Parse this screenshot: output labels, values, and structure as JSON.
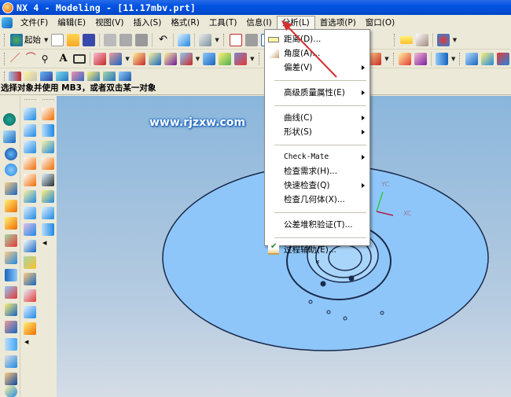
{
  "window": {
    "title": "NX 4 - Modeling - [11.17mbv.prt]"
  },
  "menubar": {
    "items": [
      {
        "label": "文件(F)"
      },
      {
        "label": "编辑(E)"
      },
      {
        "label": "视图(V)"
      },
      {
        "label": "插入(S)"
      },
      {
        "label": "格式(R)"
      },
      {
        "label": "工具(T)"
      },
      {
        "label": "信息(I)"
      },
      {
        "label": "分析(L)",
        "active": true
      },
      {
        "label": "首选项(P)"
      },
      {
        "label": "窗口(O)"
      }
    ]
  },
  "toolbar": {
    "start_label": "起始"
  },
  "prompt": {
    "text": "选择对象并使用 MB3，或者双击某一对象"
  },
  "viewport": {
    "watermark": "www.rjzxw.com",
    "model_color": "#8ec6fa",
    "axis_labels": {
      "x": "XC",
      "y": "YC"
    }
  },
  "analysis_menu": {
    "items": [
      {
        "label": "距离(D)...",
        "icon": "distance-icon",
        "submenu": false
      },
      {
        "label": "角度(A)...",
        "icon": "angle-icon",
        "submenu": false
      },
      {
        "label": "偏差(V)",
        "submenu": true
      },
      {
        "separator": true
      },
      {
        "label": "高级质量属性(E)",
        "submenu": true
      },
      {
        "separator": true
      },
      {
        "label": "曲线(C)",
        "submenu": true
      },
      {
        "label": "形状(S)",
        "submenu": true
      },
      {
        "separator": true
      },
      {
        "label": "Check-Mate",
        "submenu": true
      },
      {
        "label": "检查需求(H)...",
        "submenu": false
      },
      {
        "label": "快速检查(Q)",
        "submenu": true
      },
      {
        "label": "检查几何体(X)...",
        "submenu": false
      },
      {
        "separator": true
      },
      {
        "label": "公差堆积验证(T)...",
        "submenu": false
      },
      {
        "separator": true
      },
      {
        "label": "过程辅助(E)...",
        "icon": "process-assist-icon",
        "submenu": false
      }
    ],
    "expand_glyph": "»"
  },
  "colors": {
    "titlebar": "#0054e3",
    "annotation_arrow": "#d32f2f",
    "viewport_bg": "#8ab6dc"
  }
}
